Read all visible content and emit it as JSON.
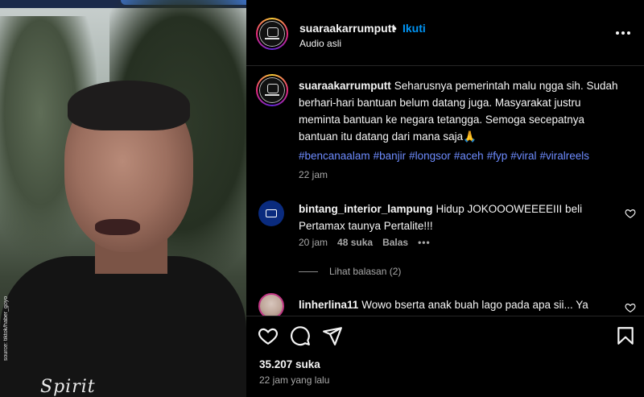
{
  "video": {
    "source_text": "source: tiktok/haber_goyo",
    "shirt_print": "Spirit"
  },
  "header": {
    "username": "suaraakarrumputt",
    "separator": "•",
    "follow_label": "Ikuti",
    "audio_label": "Audio asli"
  },
  "caption": {
    "username": "suaraakarrumputt",
    "text": "Seharusnya pemerintah malu ngga sih. Sudah berhari-hari bantuan belum datang juga. Masyarakat justru meminta bantuan ke negara tetangga. Semoga secepatnya bantuan itu datang dari mana saja🙏",
    "hashtags": [
      "#bencanaalam",
      "#banjir",
      "#longsor",
      "#aceh",
      "#fyp",
      "#viral",
      "#viralreels"
    ],
    "time": "22 jam"
  },
  "comments": [
    {
      "username": "bintang_interior_lampung",
      "text": "Hidup JOKOOOWEEEEIII beli Pertamax taunya Pertalite!!!",
      "time": "20 jam",
      "likes": "48 suka",
      "reply_label": "Balas",
      "more": "•••",
      "view_replies": "Lihat balasan (2)"
    },
    {
      "username": "linherlina11",
      "text": "Wowo bserta anak buah lago pada apa sii... Ya"
    }
  ],
  "footer": {
    "likes_count": "35.207 suka",
    "post_time": "22 jam yang lalu"
  },
  "icons": {
    "like": "heart-icon",
    "comment": "comment-icon",
    "share": "share-icon",
    "save": "bookmark-icon",
    "more": "more-horizontal-icon"
  },
  "colors": {
    "background": "#000000",
    "text": "#f5f5f5",
    "secondary": "#a8a8a8",
    "link": "#0095f6",
    "hashtag": "#6e8cff"
  }
}
